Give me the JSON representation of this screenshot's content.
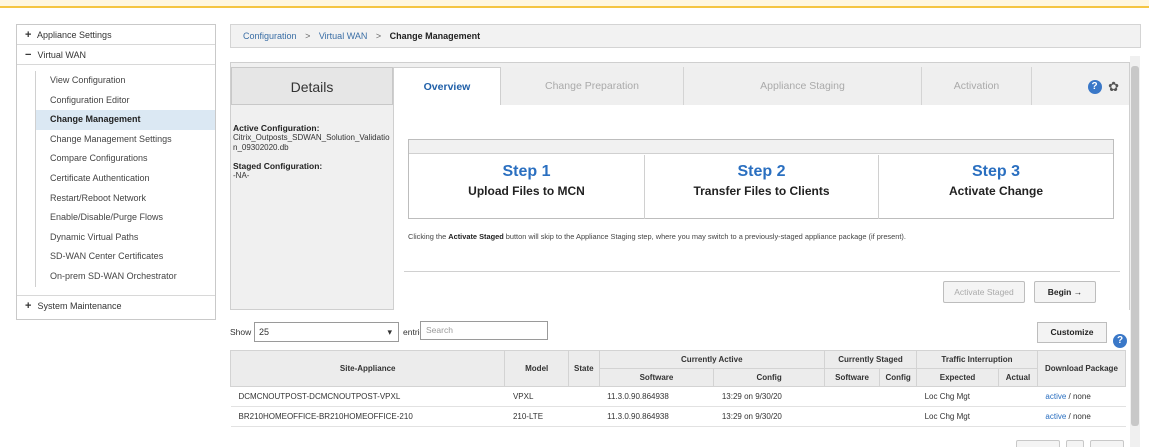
{
  "sidebar": {
    "appliance_settings": {
      "sign": "+",
      "label": "Appliance Settings"
    },
    "virtual_wan": {
      "sign": "−",
      "label": "Virtual WAN"
    },
    "items": [
      {
        "label": "View Configuration"
      },
      {
        "label": "Configuration Editor"
      },
      {
        "label": "Change Management"
      },
      {
        "label": "Change Management Settings"
      },
      {
        "label": "Compare Configurations"
      },
      {
        "label": "Certificate Authentication"
      },
      {
        "label": "Restart/Reboot Network"
      },
      {
        "label": "Enable/Disable/Purge Flows"
      },
      {
        "label": "Dynamic Virtual Paths"
      },
      {
        "label": "SD-WAN Center Certificates"
      },
      {
        "label": "On-prem SD-WAN Orchestrator"
      }
    ],
    "system_maintenance": {
      "sign": "+",
      "label": "System Maintenance"
    }
  },
  "breadcrumb": {
    "c1": "Configuration",
    "c2": "Virtual WAN",
    "current": "Change Management",
    "sep": ">"
  },
  "details": {
    "tab_label": "Details",
    "active_label": "Active Configuration:",
    "active_value": "Citrix_Outposts_SDWAN_Solution_Validation_09302020.db",
    "staged_label": "Staged Configuration:",
    "staged_value": "-NA-"
  },
  "tabs": {
    "overview": "Overview",
    "preparation": "Change Preparation",
    "staging": "Appliance Staging",
    "activation": "Activation",
    "help": "?",
    "gear": "✿"
  },
  "steps": [
    {
      "title": "Step 1",
      "desc": "Upload Files to MCN"
    },
    {
      "title": "Step 2",
      "desc": "Transfer Files to Clients"
    },
    {
      "title": "Step 3",
      "desc": "Activate Change"
    }
  ],
  "note": {
    "before": "Clicking the ",
    "bold": "Activate Staged",
    "after": " button will skip to the Appliance Staging step, where you may switch to a previously-staged appliance package (if present)."
  },
  "buttons": {
    "activate_staged": "Activate Staged",
    "begin": "Begin →",
    "customize": "Customize"
  },
  "table_controls": {
    "show": "Show",
    "entries_value": "25",
    "entries": "entries",
    "search_placeholder": "Search"
  },
  "table": {
    "headers": {
      "site": "Site-Appliance",
      "model": "Model",
      "state": "State",
      "active": "Currently Active",
      "staged": "Currently Staged",
      "interruption": "Traffic Interruption",
      "download": "Download Package",
      "software": "Software",
      "config": "Config",
      "s_software": "Software",
      "s_config": "Config",
      "expected": "Expected",
      "actual": "Actual"
    },
    "rows": [
      {
        "site": "DCMCNOUTPOST-DCMCNOUTPOST-VPXL",
        "model": "VPXL",
        "state": "",
        "software": "11.3.0.90.864938",
        "config": "13:29 on 9/30/20",
        "s_software": "",
        "s_config": "",
        "expected": "Loc Chg Mgt",
        "actual": "",
        "dl_active": "active",
        "dl_sep": " / ",
        "dl_none": "none"
      },
      {
        "site": "BR210HOMEOFFICE-BR210HOMEOFFICE-210",
        "model": "210-LTE",
        "state": "",
        "software": "11.3.0.90.864938",
        "config": "13:29 on 9/30/20",
        "s_software": "",
        "s_config": "",
        "expected": "Loc Chg Mgt",
        "actual": "",
        "dl_active": "active",
        "dl_sep": " / ",
        "dl_none": "none"
      }
    ]
  },
  "colors": {
    "accent_blue": "#2a6fc0",
    "active_sidebar_bg": "#dbe8f3",
    "top_bar_border": "#f5c542"
  }
}
